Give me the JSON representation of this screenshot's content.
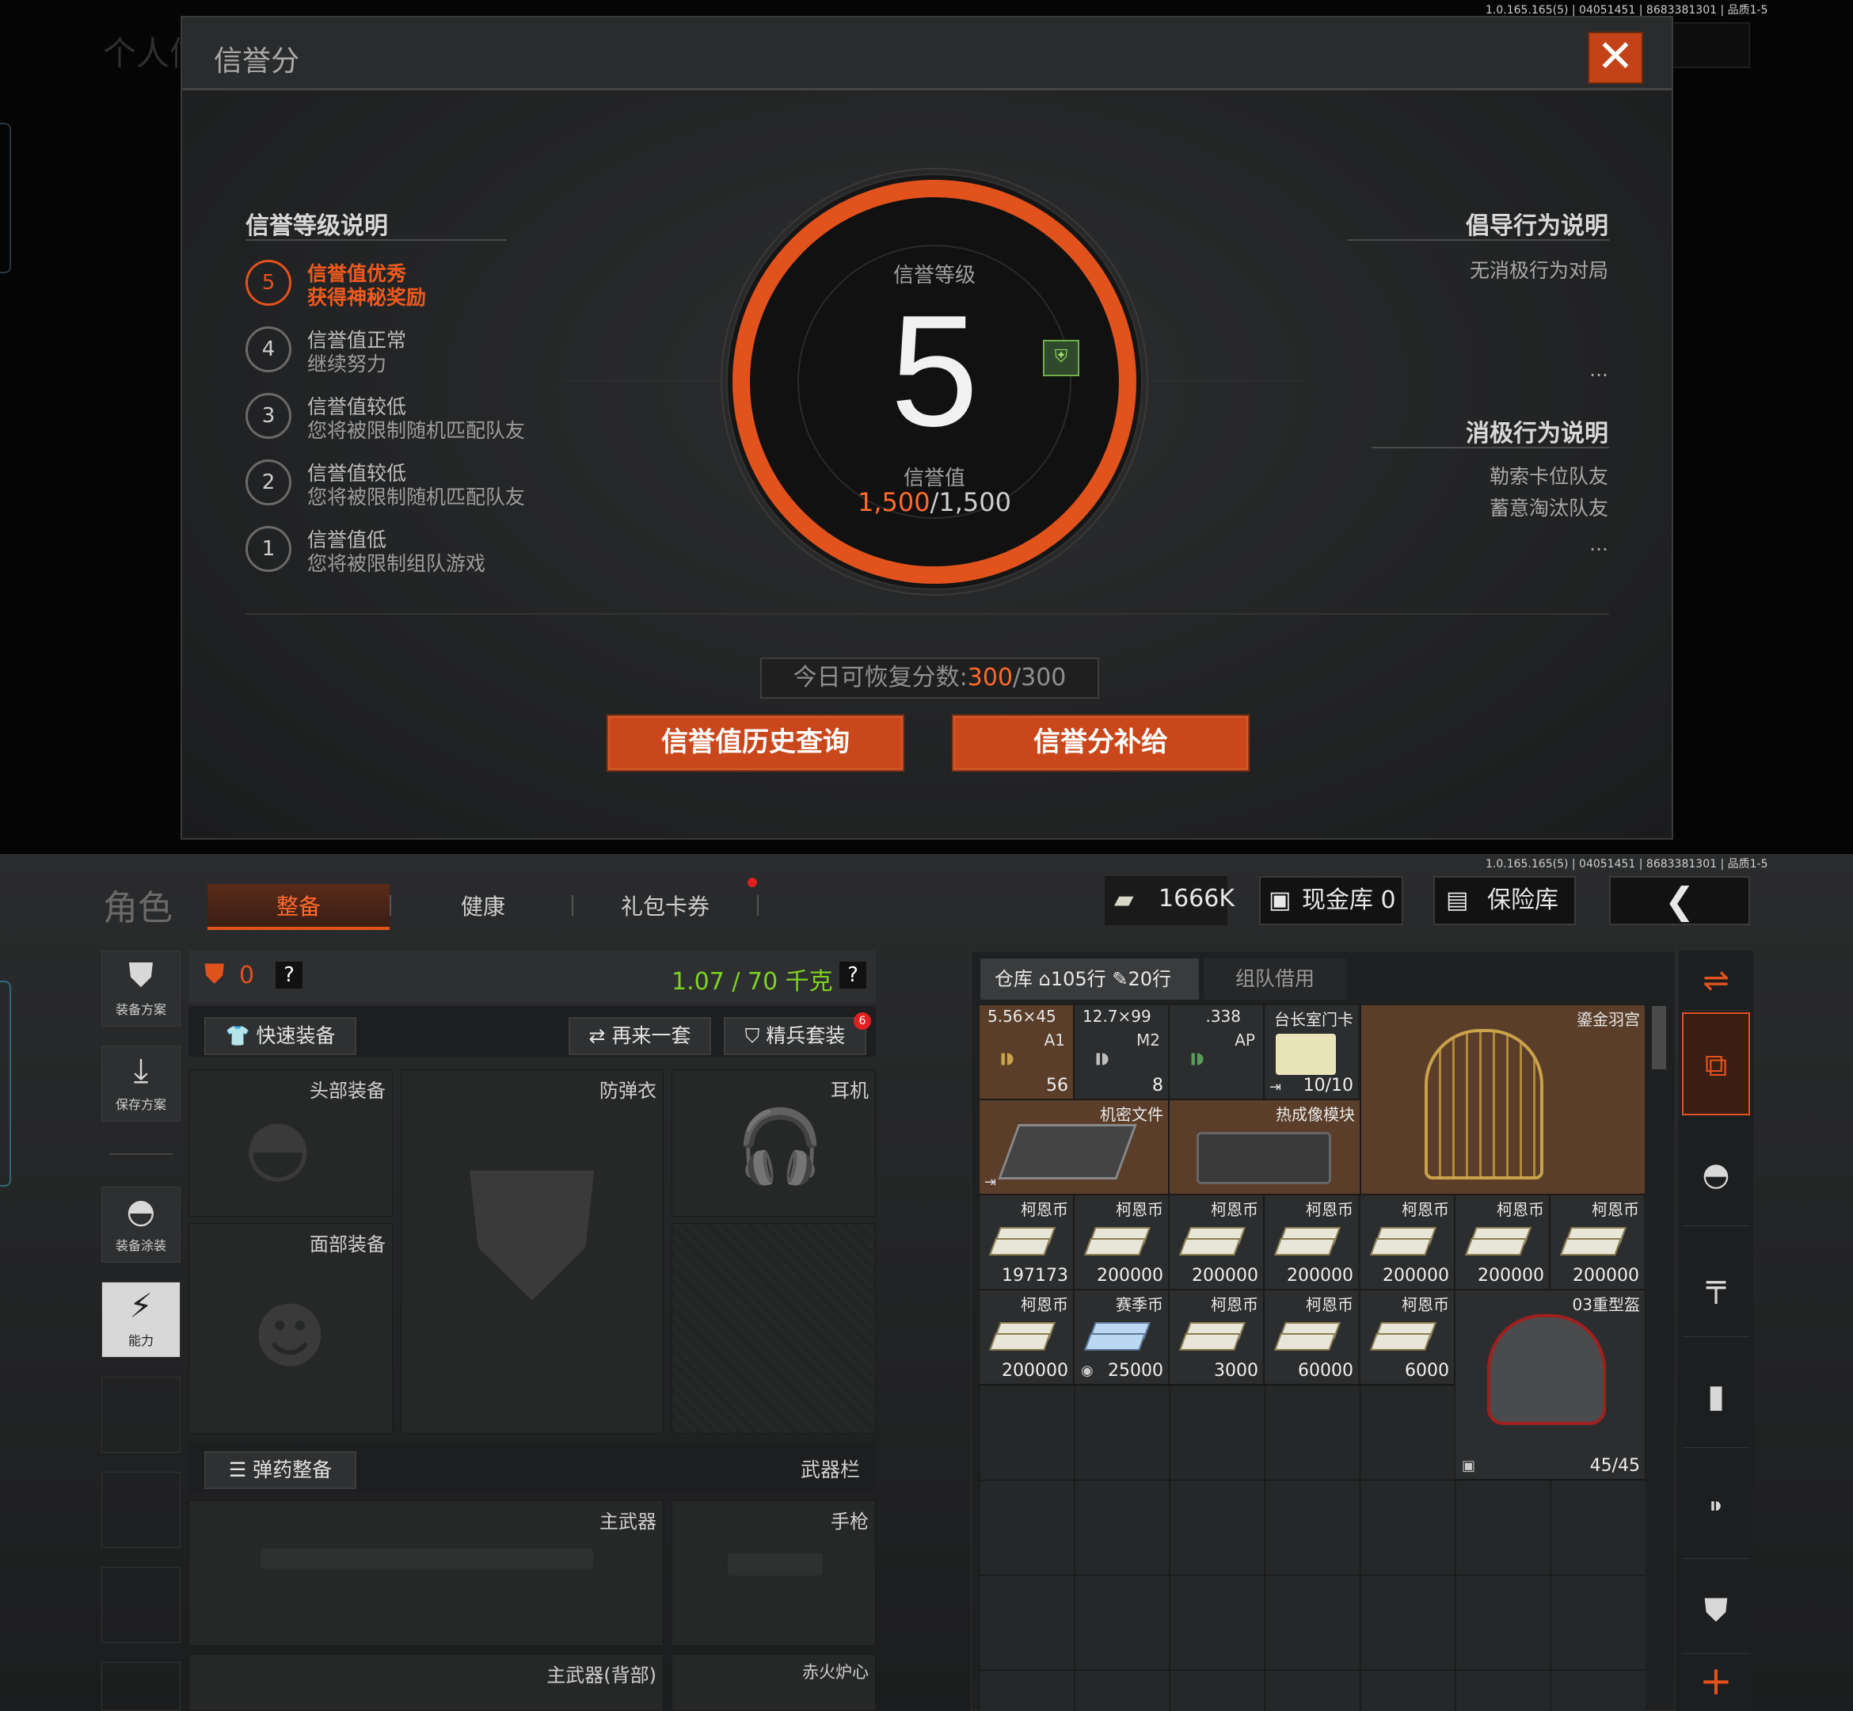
{
  "version_text": "1.0.165.165(5) | 04051451 | 8683381301 | 品质1-5",
  "top_bg": {
    "left_title": "个人信"
  },
  "modal": {
    "title": "信誉分",
    "close_glyph": "✕",
    "left_section_title": "信誉等级说明",
    "levels": [
      {
        "num": "5",
        "line1": "信誉值优秀",
        "line2": "获得神秘奖励",
        "active": true
      },
      {
        "num": "4",
        "line1": "信誉值正常",
        "line2": "继续努力",
        "active": false
      },
      {
        "num": "3",
        "line1": "信誉值较低",
        "line2": "您将被限制随机匹配队友",
        "active": false
      },
      {
        "num": "2",
        "line1": "信誉值较低",
        "line2": "您将被限制随机匹配队友",
        "active": false
      },
      {
        "num": "1",
        "line1": "信誉值低",
        "line2": "您将被限制组队游戏",
        "active": false
      }
    ],
    "ring": {
      "label_top": "信誉等级",
      "level": "5",
      "label_bottom": "信誉值",
      "value_current": "1,500",
      "value_sep_max": "/1,500"
    },
    "right_positive_title": "倡导行为说明",
    "right_positive_items": [
      "无消极行为对局"
    ],
    "ellipsis": "...",
    "right_negative_title": "消极行为说明",
    "right_negative_items": [
      "勒索卡位队友",
      "蓄意淘汰队友"
    ],
    "restore_label": "今日可恢复分数:",
    "restore_current": "300",
    "restore_max": "/300",
    "btn_history": "信誉值历史查询",
    "btn_supply": "信誉分补给"
  },
  "bottom": {
    "page_title": "角色",
    "tabs": [
      "整备",
      "健康",
      "礼包卡券"
    ],
    "currency": "1666K",
    "cash_store": "现金库 0",
    "safe_box": "保险库",
    "left_buttons": [
      "装备方案",
      "保存方案",
      "装备涂装",
      "能力"
    ],
    "armor_count": "0",
    "weight": "1.07 / 70 千克",
    "quick_equip": "快速装备",
    "again": "再来一套",
    "elite": "精兵套装",
    "elite_badge": "6",
    "slots": {
      "head": "头部装备",
      "vest": "防弹衣",
      "ear": "耳机",
      "face": "面部装备",
      "ammo_btn": "弹药整备",
      "weapon_bar": "武器栏",
      "primary": "主武器",
      "pistol": "手枪",
      "primary_back": "主武器(背部)",
      "melee": "赤火炉心"
    },
    "warehouse_tab": "仓库",
    "warehouse_rows": "105行",
    "warehouse_extra": "20行",
    "team_tab": "组队借用",
    "items_row1": [
      {
        "name": "5.56×45",
        "sub": "A1",
        "qty": "56"
      },
      {
        "name": "12.7×99",
        "sub": "M2",
        "qty": "8"
      },
      {
        "name": ".338",
        "sub": "AP",
        "qty": ""
      },
      {
        "name": "台长室门卡",
        "sub": "",
        "qty": "10/10"
      }
    ],
    "birdcage": "鎏金羽宫",
    "secret_file": "机密文件",
    "thermal": "热成像模块",
    "money_row1": [
      {
        "name": "柯恩币",
        "qty": "197173"
      },
      {
        "name": "柯恩币",
        "qty": "200000"
      },
      {
        "name": "柯恩币",
        "qty": "200000"
      },
      {
        "name": "柯恩币",
        "qty": "200000"
      },
      {
        "name": "柯恩币",
        "qty": "200000"
      },
      {
        "name": "柯恩币",
        "qty": "200000"
      },
      {
        "name": "柯恩币",
        "qty": "200000"
      }
    ],
    "money_row2": [
      {
        "name": "柯恩币",
        "qty": "200000"
      },
      {
        "name": "赛季币",
        "qty": "25000"
      },
      {
        "name": "柯恩币",
        "qty": "3000"
      },
      {
        "name": "柯恩币",
        "qty": "60000"
      },
      {
        "name": "柯恩币",
        "qty": "6000"
      }
    ],
    "helmet": {
      "name": "03重型盔",
      "qty": "45/45"
    },
    "plus": "+"
  },
  "colors": {
    "accent": "#e2521d",
    "weight_green": "#7ed321",
    "warm_cell": "#5a3e2a"
  }
}
